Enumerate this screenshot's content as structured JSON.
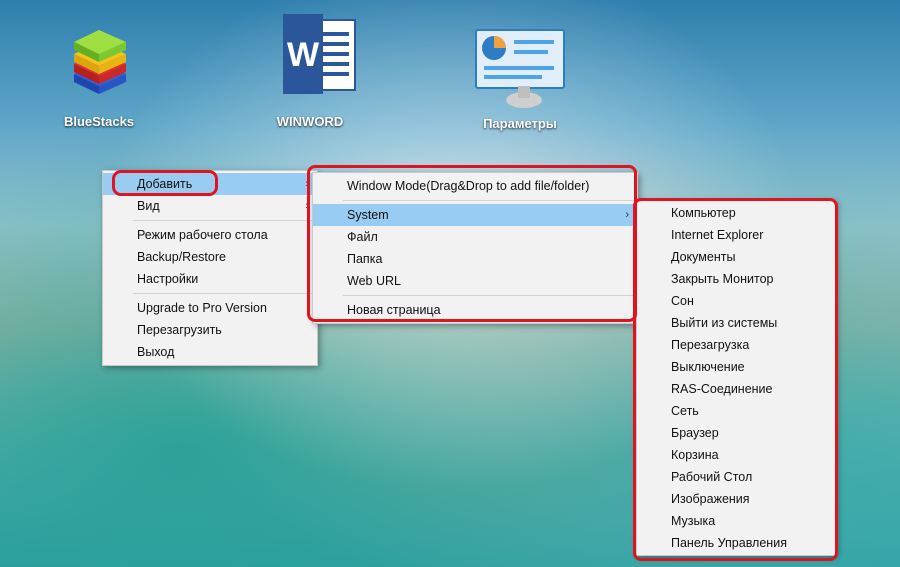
{
  "desktop": {
    "icons": [
      {
        "label": "BlueStacks",
        "icon": "bluestacks-icon"
      },
      {
        "label": "WINWORD",
        "icon": "word-icon"
      },
      {
        "label": "Параметры",
        "icon": "settings-icon"
      }
    ]
  },
  "main_menu": {
    "items": [
      {
        "label": "Добавить",
        "submenu": true,
        "highlighted": true
      },
      {
        "label": "Вид",
        "submenu": true
      },
      {
        "label": "Режим рабочего стола"
      },
      {
        "label": "Backup/Restore"
      },
      {
        "label": "Настройки"
      },
      {
        "label": "Upgrade to Pro Version"
      },
      {
        "label": "Перезагрузить"
      },
      {
        "label": "Выход"
      }
    ]
  },
  "add_menu": {
    "items": [
      {
        "label": "Window Mode(Drag&Drop to add file/folder)"
      },
      {
        "label": "System",
        "submenu": true,
        "highlighted": true
      },
      {
        "label": "Файл"
      },
      {
        "label": "Папка"
      },
      {
        "label": "Web URL"
      },
      {
        "label": "Новая страница"
      }
    ]
  },
  "system_menu": {
    "items": [
      "Компьютер",
      "Internet Explorer",
      "Документы",
      "Закрыть Монитор",
      "Сон",
      "Выйти из системы",
      "Перезагрузка",
      "Выключение",
      "RAS-Соединение",
      "Сеть",
      "Браузер",
      "Корзина",
      "Рабочий Стол",
      "Изображения",
      "Музыка",
      "Панель Управления"
    ]
  },
  "colors": {
    "highlight": "#99ccf2",
    "annotation": "#e0141e",
    "menu_bg": "#f2f2f2"
  }
}
